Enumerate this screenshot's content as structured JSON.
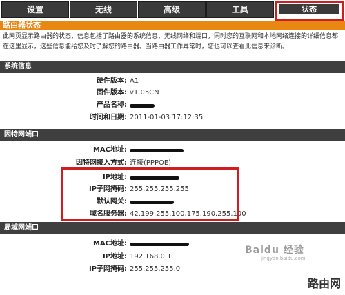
{
  "nav": {
    "tabs": [
      {
        "label": "设置"
      },
      {
        "label": "无线"
      },
      {
        "label": "高级"
      },
      {
        "label": "工具"
      },
      {
        "label": "状态"
      }
    ]
  },
  "page": {
    "title": "路由器状态",
    "intro": "此网页显示路由器的状态，信息包括了路由器的系统信息、无线网络和端口，同时您的互联网和本地网络连接的详细信息都在这里显示，这些信息能给您及时了解您的路由器。当路由器工作异常时，您也可以查看此信息来诊断。"
  },
  "system": {
    "heading": "系统信息",
    "hw_label": "硬件版本",
    "hw_value": "A1",
    "fw_label": "固件版本",
    "fw_value": "v1.05CN",
    "name_label": "产品名称",
    "time_label": "时间和日期",
    "time_value": "2011-01-03 17:12:35"
  },
  "wan": {
    "heading": "因特网端口",
    "mac_label": "MAC地址",
    "type_label": "因特网接入方式",
    "type_value": "连接(PPPOE)",
    "ip_label": "IP地址",
    "mask_label": "IP子网掩码",
    "mask_value": "255.255.255.255",
    "gw_label": "默认网关",
    "dns_label": "域名服务器",
    "dns_value": "42.199.255.100,175.190.255.100"
  },
  "lan": {
    "heading": "局域网端口",
    "mac_label": "MAC地址",
    "ip_label": "IP地址",
    "ip_value": "192.168.0.1",
    "mask_label": "IP子网掩码",
    "mask_value": "255.255.255.0"
  },
  "watermark": {
    "baidu": "Baidu 经验",
    "url": "jingyan.baidu.com",
    "site": "路由网"
  }
}
